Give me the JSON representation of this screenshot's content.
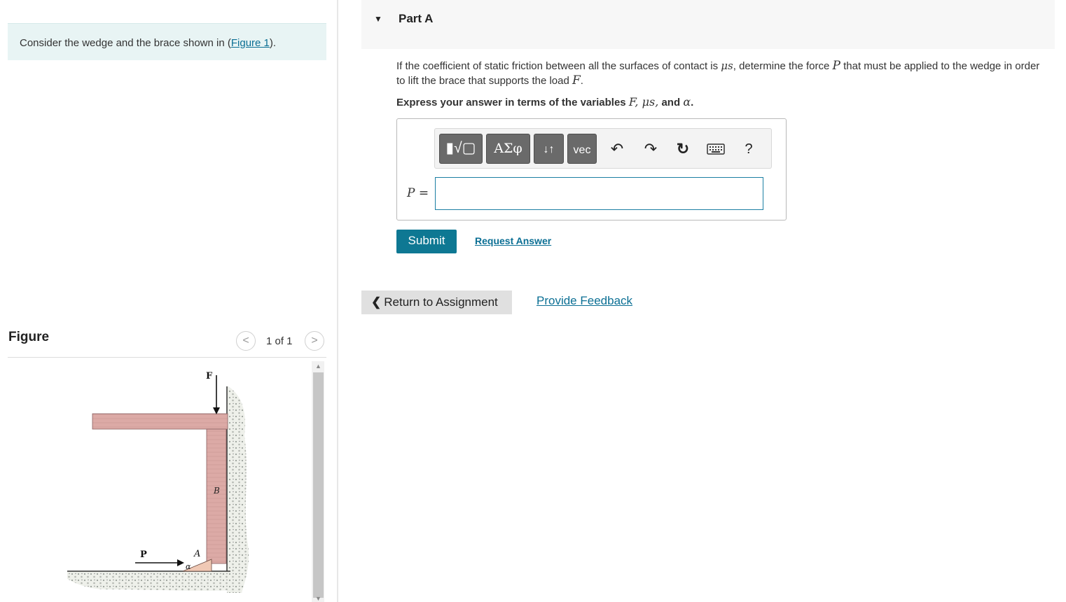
{
  "intro": {
    "text_before": "Consider the wedge and the brace shown in (",
    "figure_link": "Figure 1",
    "text_after": ")."
  },
  "figure_panel": {
    "title": "Figure",
    "pager": "1 of 1",
    "labels": {
      "force": "F",
      "push": "P",
      "point_a": "A",
      "point_b": "B",
      "angle": "α"
    }
  },
  "part": {
    "title": "Part A",
    "question_1": "If the coefficient of static friction between all the surfaces of contact is ",
    "mu_s": "μs",
    "question_2": ", determine the force ",
    "p_var": "P",
    "question_3": " that must be applied to the wedge in order to lift the brace that supports the load ",
    "f_var": "F",
    "question_4": ".",
    "express_prefix": "Express your answer in terms of the variables ",
    "express_vars": "F, μs,",
    "express_and": " and ",
    "express_alpha": "α",
    "express_end": "."
  },
  "toolbar": {
    "templates": "▮√▢",
    "greek": "ΑΣφ",
    "arrows": "↓↑",
    "vec": "vec",
    "undo": "↶",
    "redo": "↷",
    "reset": "↻",
    "help": "?"
  },
  "answer": {
    "label": "P =",
    "value": ""
  },
  "actions": {
    "submit": "Submit",
    "request": "Request Answer",
    "return": "Return to Assignment",
    "feedback": "Provide Feedback"
  },
  "colors": {
    "accent": "#0e7893",
    "link": "#0b6f94",
    "intro_bg": "#e8f4f4",
    "wood": "#d9a9a6"
  },
  "icons": [
    "caret-down-icon",
    "chevron-left-icon",
    "chevron-right-icon",
    "undo-icon",
    "redo-icon",
    "reset-icon",
    "keyboard-icon",
    "help-icon"
  ]
}
